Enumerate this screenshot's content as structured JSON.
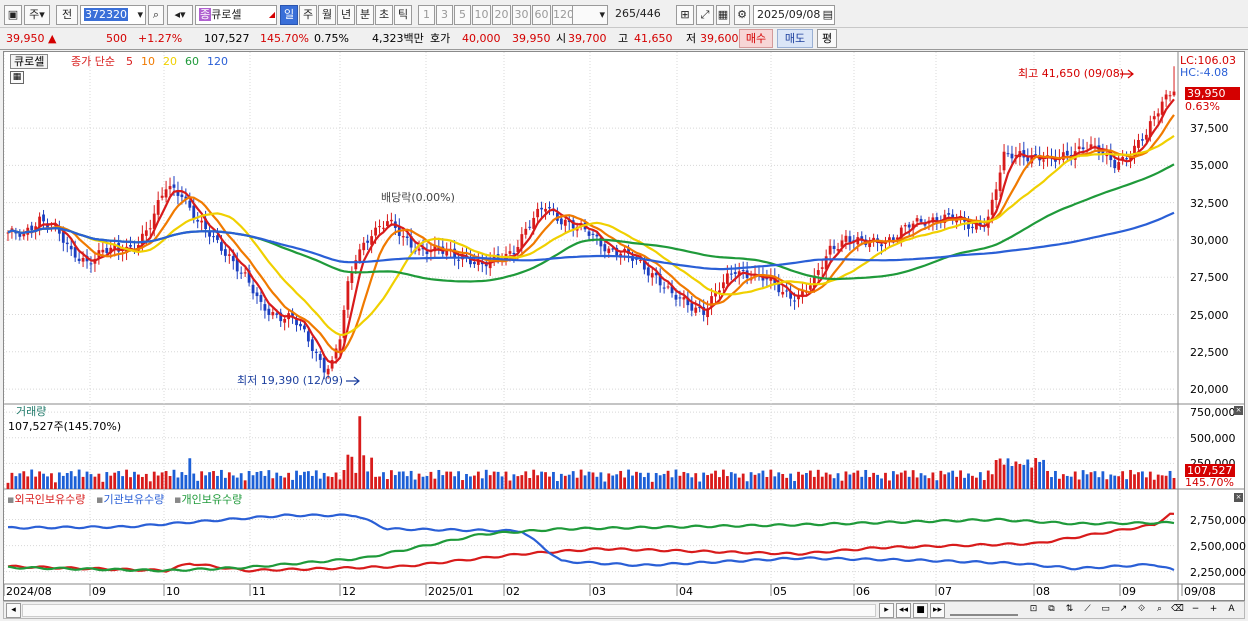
{
  "toolbar": {
    "period_label": "주",
    "prev_label": "전",
    "code": "372320",
    "stock_name": "큐로셀",
    "stock_badge": "종",
    "periods": [
      "일",
      "주",
      "월",
      "년",
      "분",
      "초",
      "틱"
    ],
    "intervals": [
      "1",
      "3",
      "5",
      "10",
      "20",
      "30",
      "60",
      "120"
    ],
    "count": "265",
    "count_total": "/446",
    "date": "2025/09/08"
  },
  "info": {
    "price": "39,950",
    "up_arrow": "▲",
    "change": "500",
    "change_pct": "+1.27%",
    "volume": "107,527",
    "volume_pct": "145.70%",
    "turnover": "0.75%",
    "amount": "4,323백만",
    "quote_label": "호가",
    "ask": "40,000",
    "bid": "39,950",
    "open_label": "시",
    "open": "39,700",
    "high_label": "고",
    "high": "41,650",
    "low_label": "저",
    "low": "39,600",
    "buy_label": "매수",
    "sell_label": "매도",
    "flat_label": "평"
  },
  "price_panel": {
    "name": "큐로셀",
    "ma_title": "종가 단순",
    "ma_periods": [
      {
        "label": "5",
        "color": "#d81b1b"
      },
      {
        "label": "10",
        "color": "#f07a00"
      },
      {
        "label": "20",
        "color": "#f0d000"
      },
      {
        "label": "60",
        "color": "#1f9a3a"
      },
      {
        "label": "120",
        "color": "#2a5fd6"
      }
    ],
    "lc": "LC:106.03",
    "hc": "HC:-4.08",
    "current_price": "39,950",
    "current_pct": "0.63%",
    "max_label": "최고 41,650 (09/08)",
    "min_label": "최저 19,390 (12/09)",
    "dividend_label": "배당락(0.00%)",
    "y_ticks": [
      "37,500",
      "35,000",
      "32,500",
      "30,000",
      "27,500",
      "25,000",
      "22,500",
      "20,000"
    ]
  },
  "volume_panel": {
    "title": "거래량",
    "value": "107,527주(145.70%)",
    "y_ticks": [
      "750,000",
      "500,000",
      "250,000"
    ],
    "current": "107,527",
    "current_pct": "145.70%"
  },
  "holdings_panel": {
    "series": [
      {
        "label": "외국인보유수량",
        "color": "#d81b1b"
      },
      {
        "label": "기관보유수량",
        "color": "#2a5fd6"
      },
      {
        "label": "개인보유수량",
        "color": "#1f9a3a"
      }
    ],
    "y_ticks": [
      "2,750,000",
      "2,500,000",
      "2,250,000"
    ]
  },
  "x_axis": [
    "2024/08",
    "09",
    "10",
    "11",
    "12",
    "2025/01",
    "02",
    "03",
    "04",
    "05",
    "06",
    "07",
    "08",
    "09",
    "09/08"
  ],
  "chart_data": {
    "type": "candlestick",
    "title": "큐로셀",
    "price_keypoints": [
      [
        0,
        30500
      ],
      [
        4,
        30200
      ],
      [
        8,
        31500
      ],
      [
        12,
        30800
      ],
      [
        16,
        29000
      ],
      [
        20,
        28600
      ],
      [
        24,
        29300
      ],
      [
        28,
        29200
      ],
      [
        32,
        29600
      ],
      [
        36,
        31000
      ],
      [
        40,
        33500
      ],
      [
        44,
        33200
      ],
      [
        48,
        31200
      ],
      [
        52,
        30000
      ],
      [
        56,
        29000
      ],
      [
        60,
        27500
      ],
      [
        64,
        25500
      ],
      [
        68,
        25000
      ],
      [
        72,
        24800
      ],
      [
        76,
        23200
      ],
      [
        80,
        21500
      ],
      [
        82,
        21800
      ],
      [
        84,
        23500
      ],
      [
        86,
        26800
      ],
      [
        88,
        28800
      ],
      [
        92,
        30600
      ],
      [
        96,
        31200
      ],
      [
        100,
        30100
      ],
      [
        104,
        29400
      ],
      [
        108,
        29300
      ],
      [
        112,
        29000
      ],
      [
        116,
        28900
      ],
      [
        120,
        28200
      ],
      [
        124,
        28700
      ],
      [
        128,
        29400
      ],
      [
        132,
        31000
      ],
      [
        136,
        32300
      ],
      [
        140,
        31400
      ],
      [
        144,
        30800
      ],
      [
        148,
        30300
      ],
      [
        152,
        29400
      ],
      [
        156,
        29000
      ],
      [
        160,
        28400
      ],
      [
        164,
        27600
      ],
      [
        168,
        26200
      ],
      [
        172,
        25700
      ],
      [
        176,
        25300
      ],
      [
        180,
        26700
      ],
      [
        184,
        28000
      ],
      [
        188,
        27700
      ],
      [
        192,
        27300
      ],
      [
        196,
        26500
      ],
      [
        200,
        26200
      ],
      [
        204,
        27200
      ],
      [
        208,
        29400
      ],
      [
        212,
        30200
      ],
      [
        216,
        29700
      ],
      [
        220,
        29900
      ],
      [
        224,
        30200
      ],
      [
        228,
        30900
      ],
      [
        232,
        31300
      ],
      [
        236,
        31600
      ],
      [
        240,
        31300
      ],
      [
        244,
        30900
      ],
      [
        248,
        31500
      ],
      [
        252,
        35500
      ],
      [
        256,
        35800
      ],
      [
        260,
        35600
      ],
      [
        264,
        35200
      ],
      [
        268,
        35800
      ],
      [
        272,
        36300
      ],
      [
        276,
        35900
      ],
      [
        280,
        35200
      ],
      [
        284,
        35800
      ],
      [
        288,
        37000
      ],
      [
        292,
        39400
      ],
      [
        294,
        39950
      ]
    ],
    "ohlc_last": {
      "open": 39700,
      "high": 41650,
      "low": 39600,
      "close": 39950,
      "date": "09/08"
    },
    "moving_averages": [
      "5",
      "10",
      "20",
      "60",
      "120"
    ],
    "y_range": [
      19000,
      41800
    ],
    "volume_y_range": [
      0,
      800000
    ],
    "holdings_y_range": [
      2170000,
      2880000
    ]
  }
}
